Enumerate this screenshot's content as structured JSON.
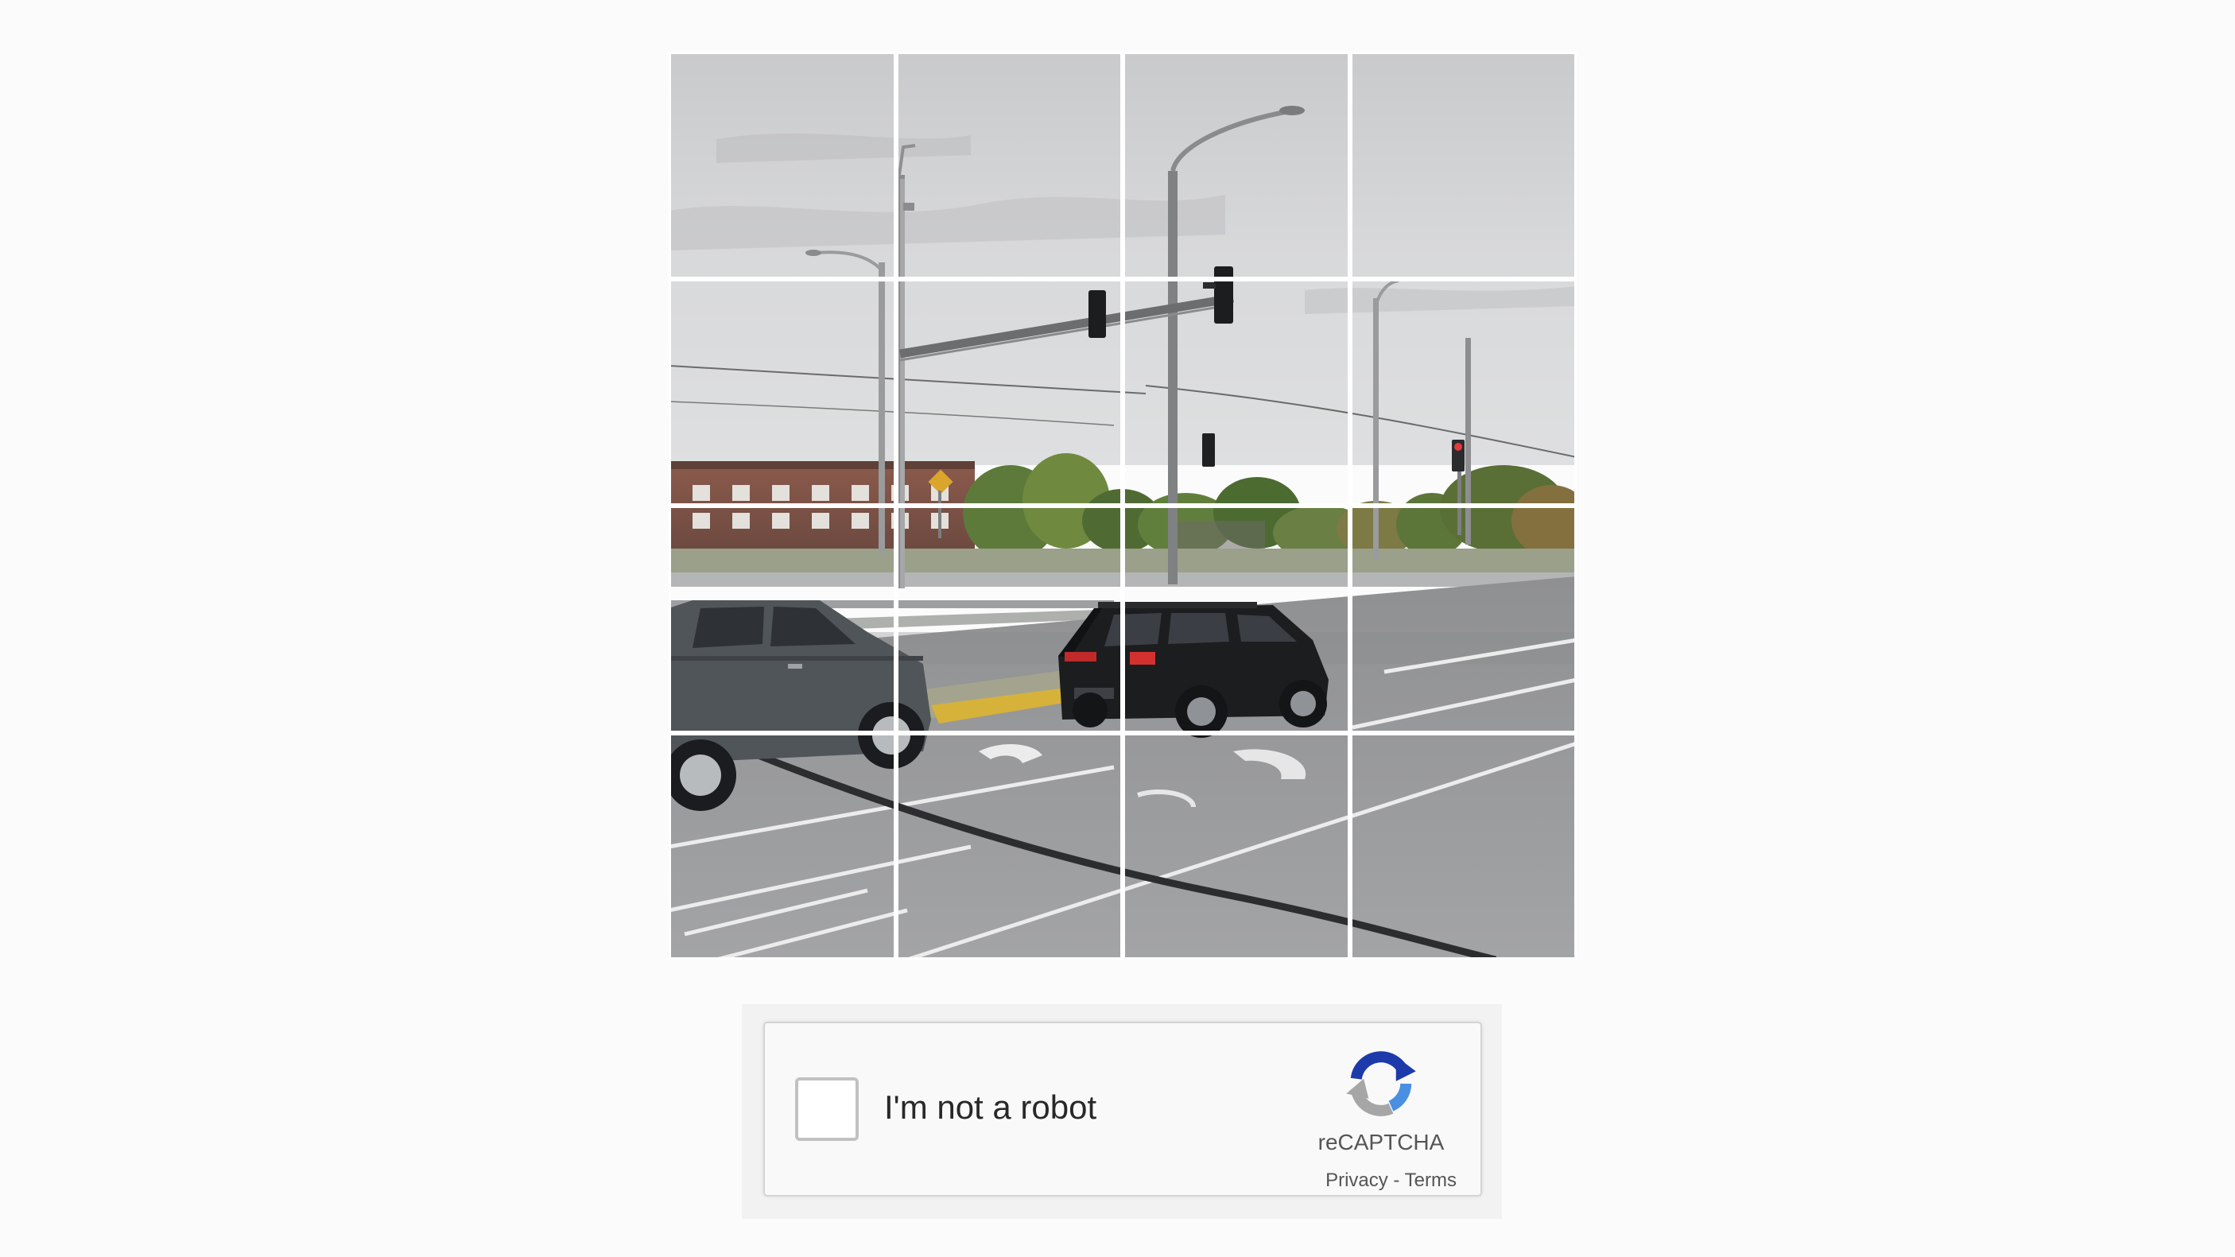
{
  "challenge": {
    "grid_rows": 4,
    "grid_cols": 4,
    "tiles": [
      {
        "row": 1,
        "col": 1
      },
      {
        "row": 1,
        "col": 2
      },
      {
        "row": 1,
        "col": 3
      },
      {
        "row": 1,
        "col": 4
      },
      {
        "row": 2,
        "col": 1
      },
      {
        "row": 2,
        "col": 2
      },
      {
        "row": 2,
        "col": 3
      },
      {
        "row": 2,
        "col": 4
      },
      {
        "row": 3,
        "col": 1
      },
      {
        "row": 3,
        "col": 2
      },
      {
        "row": 3,
        "col": 3
      },
      {
        "row": 3,
        "col": 4
      },
      {
        "row": 4,
        "col": 1
      },
      {
        "row": 4,
        "col": 2
      },
      {
        "row": 4,
        "col": 3
      },
      {
        "row": 4,
        "col": 4
      }
    ]
  },
  "recaptcha": {
    "checkbox_label": "I'm not a robot",
    "checked": false,
    "brand": "reCAPTCHA",
    "privacy_link": "Privacy",
    "separator": " - ",
    "terms_link": "Terms",
    "logo_icon": "recaptcha-logo-icon"
  },
  "colors": {
    "page_background": "#fbfbfb",
    "widget_background": "#f9f9f9",
    "widget_border": "#d3d3d3",
    "checkbox_border": "#c1c1c1",
    "logo_blue_dark": "#1c3aa9",
    "logo_blue_light": "#4a90e2",
    "logo_gray": "#a6a6a6"
  }
}
